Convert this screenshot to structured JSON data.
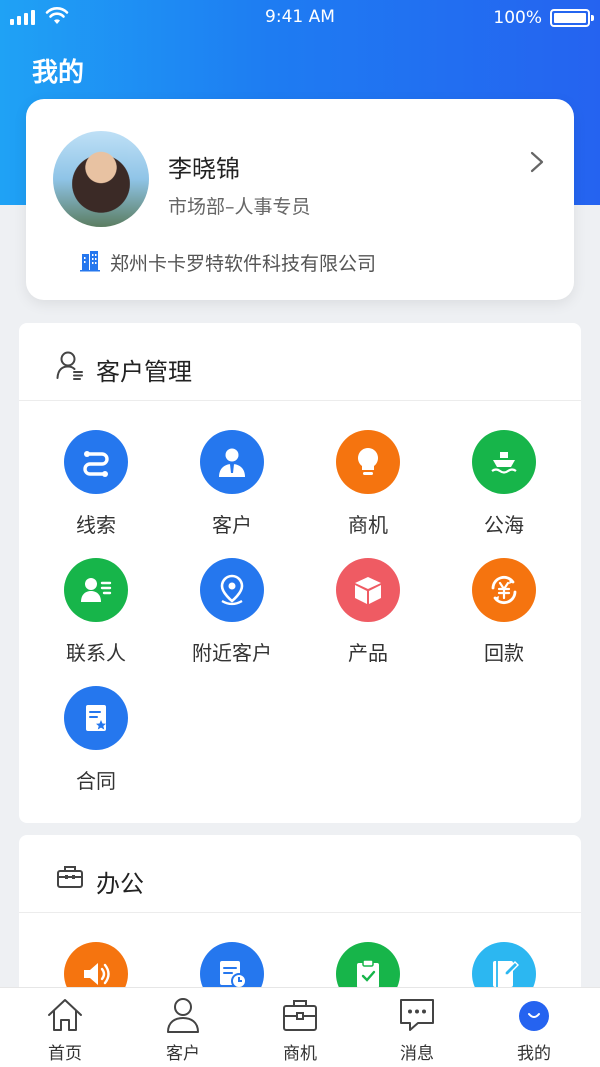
{
  "status_bar": {
    "time": "9:41 AM",
    "battery": "100%"
  },
  "page_title": "我的",
  "profile": {
    "name": "李晓锦",
    "department": "市场部–人事专员",
    "company": "郑州卡卡罗特软件科技有限公司"
  },
  "customer_section": {
    "title": "客户管理",
    "items": [
      {
        "label": "线索",
        "icon": "lead-icon",
        "color": "#2577ee"
      },
      {
        "label": "客户",
        "icon": "customer-icon",
        "color": "#2577ee"
      },
      {
        "label": "商机",
        "icon": "lightbulb-icon",
        "color": "#f5740f"
      },
      {
        "label": "公海",
        "icon": "ship-icon",
        "color": "#17b54a"
      },
      {
        "label": "联系人",
        "icon": "contact-card-icon",
        "color": "#17b54a"
      },
      {
        "label": "附近客户",
        "icon": "location-pin-icon",
        "color": "#2577ee"
      },
      {
        "label": "产品",
        "icon": "box-icon",
        "color": "#ef5b63"
      },
      {
        "label": "回款",
        "icon": "yuan-refresh-icon",
        "color": "#f5740f"
      },
      {
        "label": "合同",
        "icon": "contract-icon",
        "color": "#2577ee"
      }
    ]
  },
  "office_section": {
    "title": "办公",
    "items": [
      {
        "icon": "speaker-icon",
        "color": "#f5740f"
      },
      {
        "icon": "schedule-icon",
        "color": "#2577ee"
      },
      {
        "icon": "clipboard-check-icon",
        "color": "#17b54a"
      },
      {
        "icon": "notebook-icon",
        "color": "#2cb7f1"
      }
    ]
  },
  "tabbar": {
    "tabs": [
      {
        "label": "首页",
        "icon": "home-icon"
      },
      {
        "label": "客户",
        "icon": "person-icon"
      },
      {
        "label": "商机",
        "icon": "briefcase-icon"
      },
      {
        "label": "消息",
        "icon": "chat-bubble-icon"
      },
      {
        "label": "我的",
        "icon": "me-icon",
        "active": true
      }
    ]
  }
}
